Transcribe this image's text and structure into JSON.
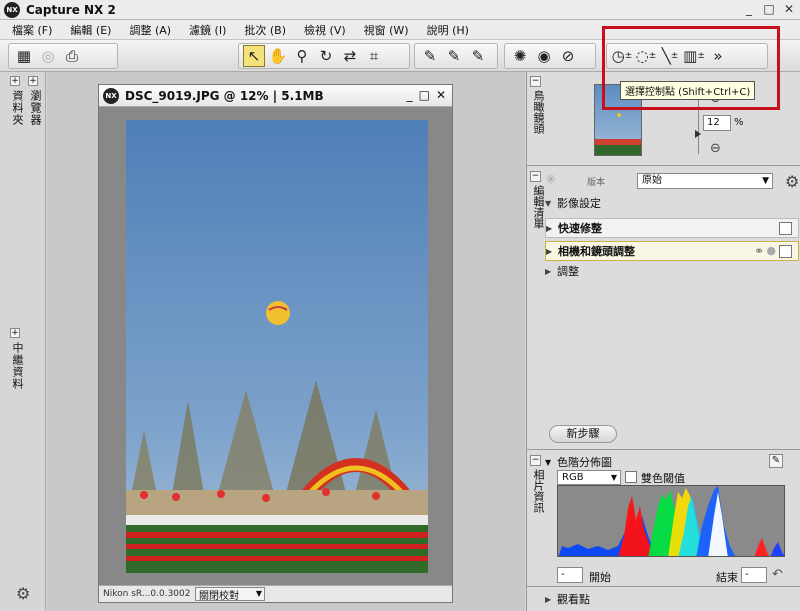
{
  "app": {
    "title": "Capture NX 2",
    "logo": "NX"
  },
  "window_controls": {
    "minimize": "_",
    "maximize": "□",
    "close": "✕"
  },
  "menu": [
    "檔案 (F)",
    "編輯 (E)",
    "調整 (A)",
    "濾鏡 (I)",
    "批次 (B)",
    "檢視 (V)",
    "視窗 (W)",
    "說明 (H)"
  ],
  "toolbar": {
    "tooltip": "選擇控制點 (Shift+Ctrl+C)",
    "highlight_color": "#c8101a"
  },
  "left_panels": {
    "folders": "資料夾",
    "browser": "瀏覽器",
    "metadata": "中繼資料"
  },
  "image_window": {
    "title": "DSC_9019.JPG @ 12% | 5.1MB",
    "status_profile": "Nikon sR...0.0.3002",
    "status_proof": "關閉校對"
  },
  "right_panel": {
    "birdseye_label": "鳥瞰鏡頭",
    "zoom_value": "12",
    "zoom_unit": "%",
    "edit_list_label": "編輯清單",
    "version_label": "版本",
    "version_value": "原始",
    "section_image_settings": "影像設定",
    "step_quick_fix": "快速修整",
    "step_camera_lens": "相機和鏡頭調整",
    "section_adjust": "調整",
    "new_step": "新步驟",
    "photo_info_label": "相片資訊",
    "histogram_title": "色階分佈圖",
    "channel": "RGB",
    "dual_threshold": "雙色閾值",
    "start_value": "-",
    "start_label": "開始",
    "end_label": "結束",
    "end_value": "-",
    "view_point": "觀看點"
  }
}
